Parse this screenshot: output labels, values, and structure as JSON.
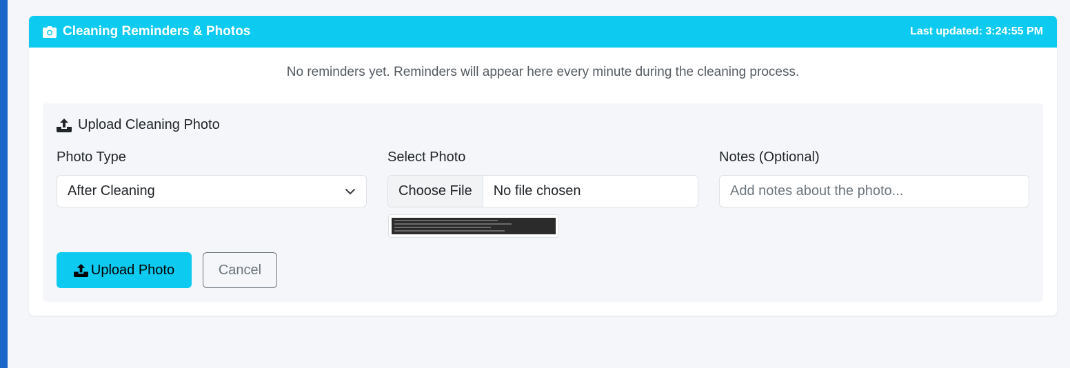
{
  "card": {
    "title": "Cleaning Reminders & Photos",
    "last_updated": "Last updated: 3:24:55 PM",
    "empty_message": "No reminders yet. Reminders will appear here every minute during the cleaning process."
  },
  "upload": {
    "title": "Upload Cleaning Photo",
    "photo_type_label": "Photo Type",
    "photo_type_value": "After Cleaning",
    "select_photo_label": "Select Photo",
    "choose_file_label": "Choose File",
    "file_status": "No file chosen",
    "notes_label": "Notes (Optional)",
    "notes_placeholder": "Add notes about the photo...",
    "upload_button": "Upload Photo",
    "cancel_button": "Cancel"
  },
  "icons": {
    "header_icon": "camera-icon",
    "panel_icon": "upload-icon",
    "select_icon": "chevron-down-icon"
  },
  "colors": {
    "header_bg": "#0dcaf0",
    "primary_button": "#0dcaf0",
    "left_strip": "#1a67c9"
  }
}
